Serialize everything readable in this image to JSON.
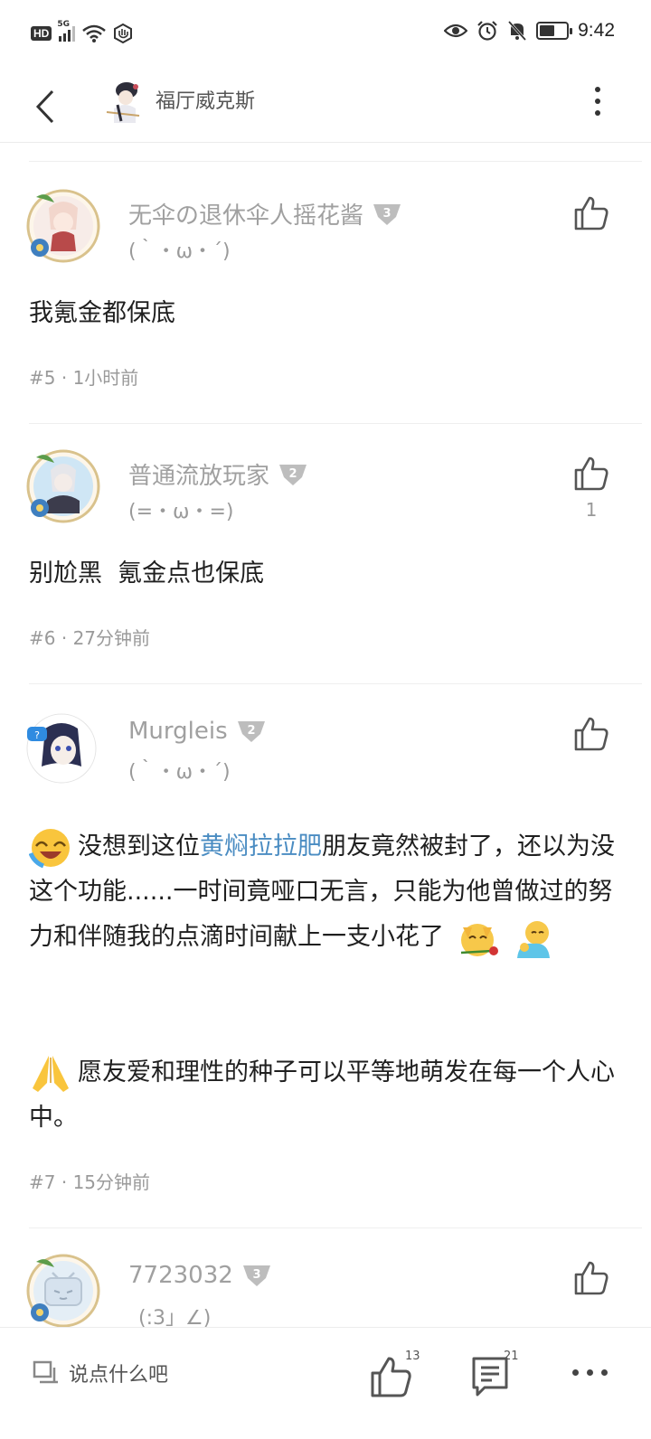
{
  "status_bar": {
    "hd": "HD",
    "network": "5G",
    "time": "9:42",
    "battery_level": 0.55
  },
  "header": {
    "title": "福厅威克斯"
  },
  "comments": [
    {
      "username": "无伞の退休伞人摇花酱",
      "level": "3",
      "signature": "(｀・ω・´)",
      "body": "我氪金都保底",
      "floor": "#5",
      "time": "1小时前",
      "likes": ""
    },
    {
      "username": "普通流放玩家",
      "level": "2",
      "signature": "(=・ω・=)",
      "body": "别尬黑  氪金点也保底",
      "floor": "#6",
      "time": "27分钟前",
      "likes": "1"
    },
    {
      "username": "Murgleis",
      "level": "2",
      "signature": "(｀・ω・´)",
      "body_part1": "没想到这位",
      "body_link": "黄焖拉拉肥",
      "body_part2": "朋友竟然被封了，还以为没这个功能......一时间竟哑口无言，只能为他曾做过的努力和伴随我的点滴时间献上一支小花了",
      "body_para2": "愿友爱和理性的种子可以平等地萌发在每一个人心中。",
      "floor": "#7",
      "time": "15分钟前",
      "likes": ""
    },
    {
      "username": "7723032",
      "level": "3",
      "signature": "_(:3」∠)_",
      "likes": ""
    }
  ],
  "bottom_bar": {
    "placeholder": "说点什么吧",
    "like_count": "13",
    "comment_count": "21"
  },
  "icons": {
    "back": "chevron-left-icon",
    "more": "more-vertical-icon",
    "like": "thumbs-up-icon",
    "comment": "comment-icon",
    "edit": "edit-icon"
  },
  "colors": {
    "link": "#4a8cc2",
    "muted_text": "#a0a0a0",
    "divider": "#efefef"
  }
}
